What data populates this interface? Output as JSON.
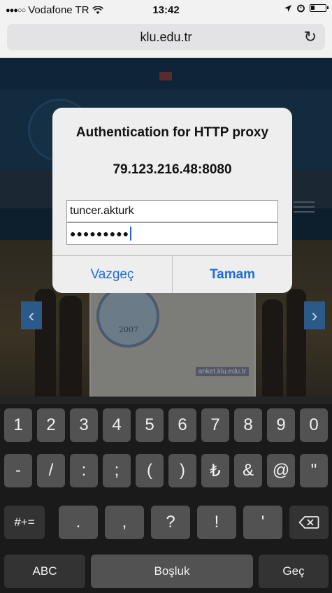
{
  "statusbar": {
    "carrier": "Vodafone TR",
    "signal_dots": "●●●○○",
    "time": "13:42",
    "icons": [
      "wifi-icon",
      "location-arrow-icon",
      "alarm-icon",
      "battery-icon"
    ]
  },
  "browser": {
    "url": "klu.edu.tr",
    "reload_icon": "↻"
  },
  "website": {
    "banner_year": "2007",
    "banner_url": "anket.klu.edu.tr"
  },
  "dialog": {
    "title": "Authentication for HTTP proxy",
    "host": "79.123.216.48:8080",
    "username_value": "tuncer.akturk",
    "password_value": "●●●●●●●●●",
    "cancel_label": "Vazgeç",
    "ok_label": "Tamam"
  },
  "keyboard": {
    "row1": [
      "1",
      "2",
      "3",
      "4",
      "5",
      "6",
      "7",
      "8",
      "9",
      "0"
    ],
    "row2": [
      "-",
      "/",
      ":",
      ";",
      "(",
      ")",
      "₺",
      "&",
      "@",
      "\""
    ],
    "row3_left": "#+=",
    "row3": [
      ".",
      ",",
      "?",
      "!",
      "'"
    ],
    "backspace_icon": "backspace-icon",
    "abc_label": "ABC",
    "space_label": "Boşluk",
    "go_label": "Geç"
  },
  "colors": {
    "accent": "#1f6ed6",
    "key": "#525252",
    "key_dark": "#333333"
  }
}
